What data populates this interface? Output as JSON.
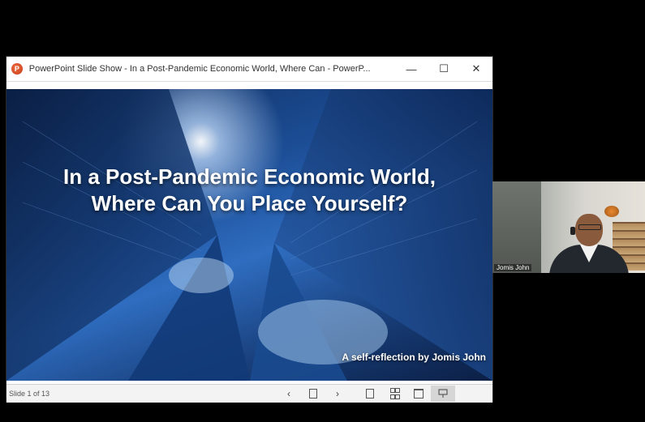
{
  "window": {
    "title": "PowerPoint Slide Show  -  In a Post-Pandemic Economic World, Where Can - PowerP...",
    "icon": "powerpoint-icon",
    "controls": {
      "minimize": "—",
      "maximize": "☐",
      "close": "✕"
    }
  },
  "slide": {
    "title_line1": "In a Post-Pandemic Economic World,",
    "title_line2": "Where Can You Place Yourself?",
    "byline": "A self-reflection by Jomis John"
  },
  "statusbar": {
    "slide_counter": "Slide 1 of 13",
    "prev": "‹",
    "next": "›"
  },
  "webcam": {
    "participant_name": "Jomis John"
  },
  "colors": {
    "background": "#000000",
    "slide_blue": "#1c4e96",
    "titlebar": "#ffffff",
    "statusbar": "#f3f3f3"
  }
}
